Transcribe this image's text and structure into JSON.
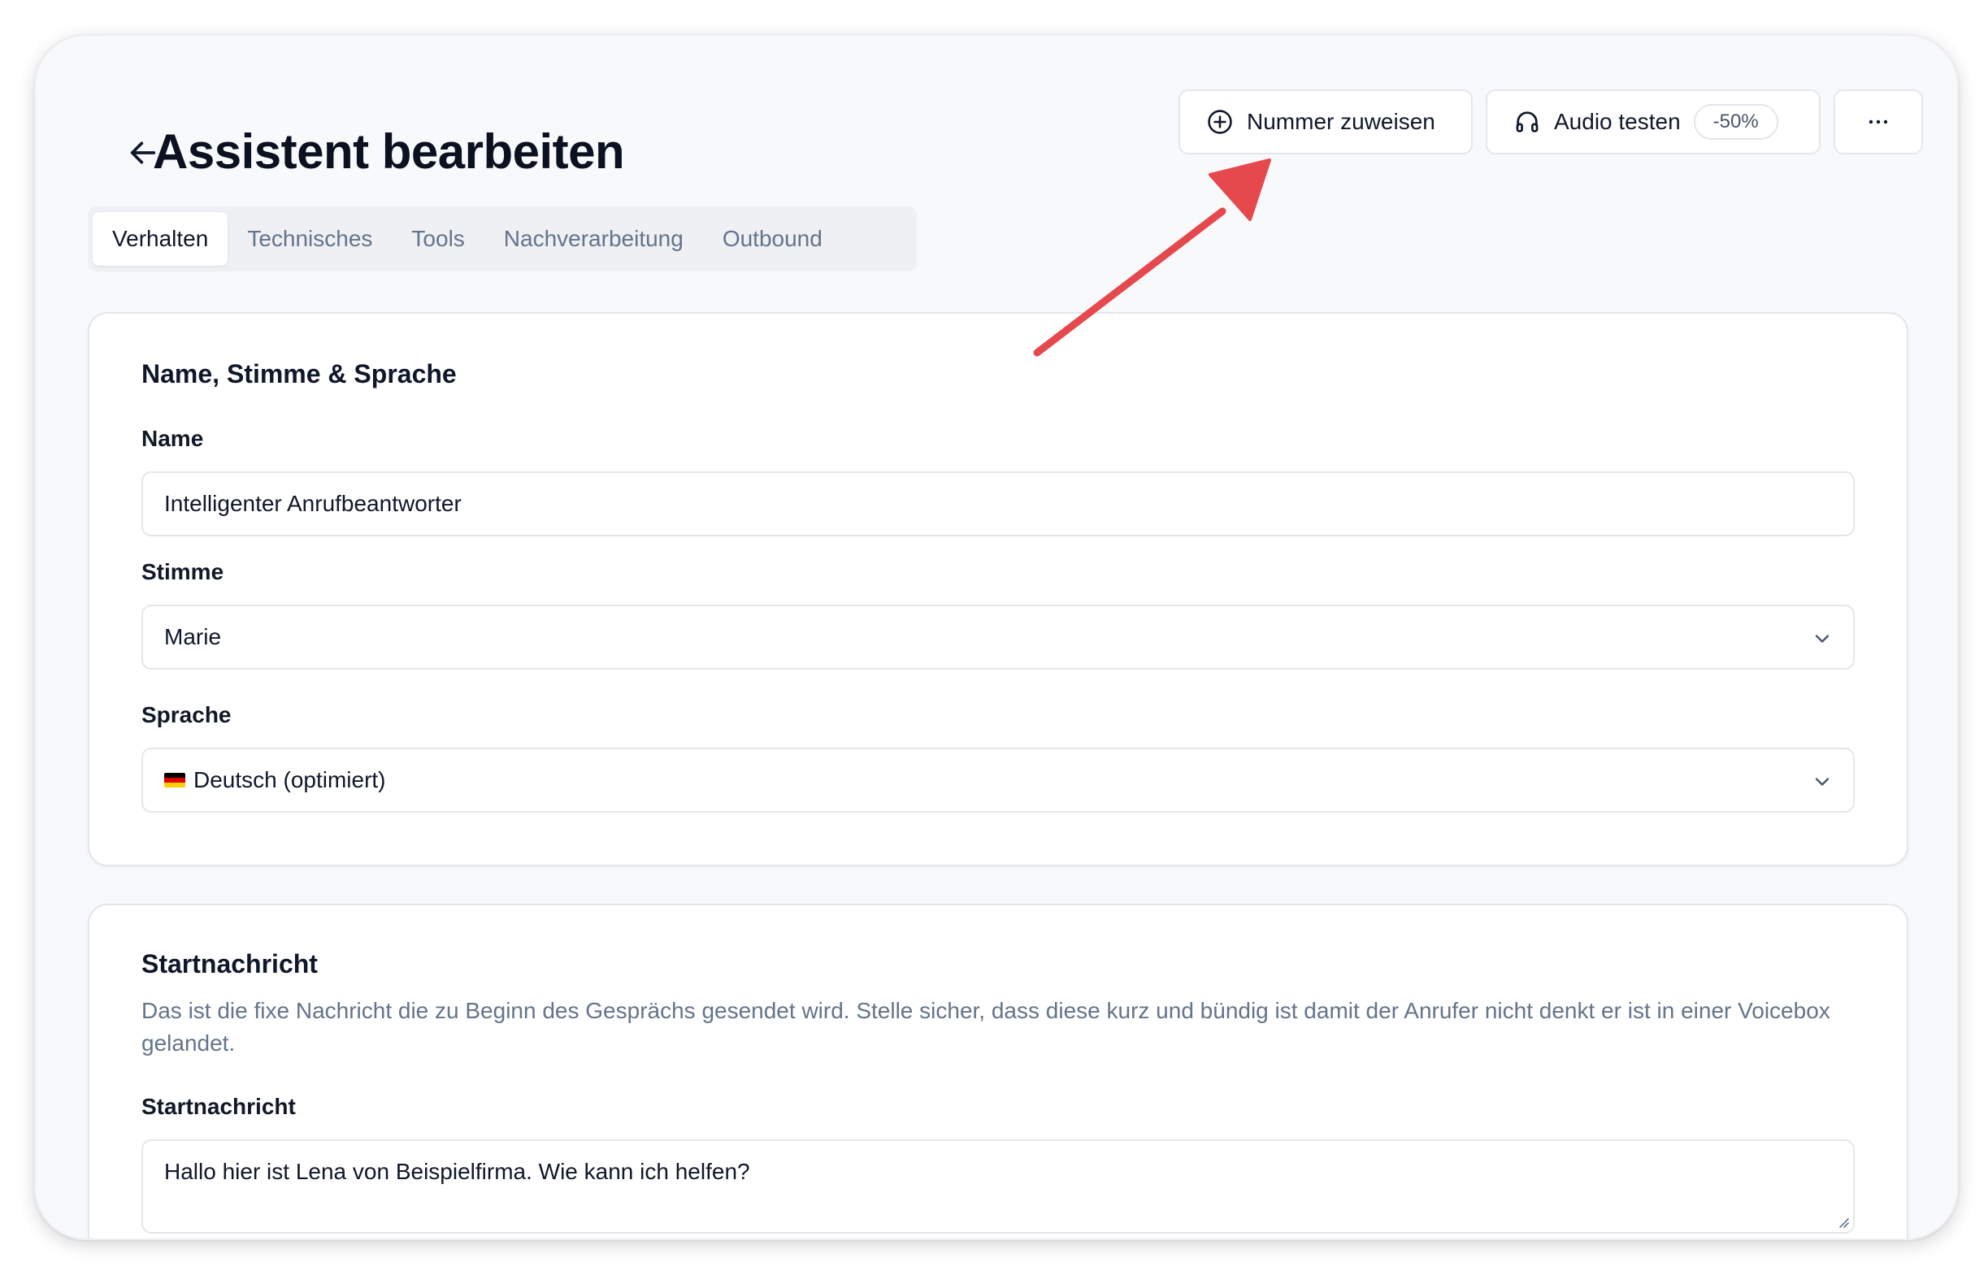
{
  "header": {
    "title": "Assistent bearbeiten",
    "back_icon": "arrow-left-icon",
    "assign_label": "Nummer zuweisen",
    "assign_icon": "plus-circle-icon",
    "audio_label": "Audio testen",
    "audio_icon": "headphones-icon",
    "audio_badge": "-50%",
    "more_icon": "more-horizontal-icon",
    "more_label": "···"
  },
  "tabs": [
    {
      "label": "Verhalten",
      "active": true
    },
    {
      "label": "Technisches",
      "active": false
    },
    {
      "label": "Tools",
      "active": false
    },
    {
      "label": "Nachverarbeitung",
      "active": false
    },
    {
      "label": "Outbound",
      "active": false
    }
  ],
  "section_voice": {
    "title": "Name, Stimme & Sprache",
    "name_label": "Name",
    "name_value": "Intelligenter Anrufbeantworter",
    "voice_label": "Stimme",
    "voice_value": "Marie",
    "language_label": "Sprache",
    "language_value": "Deutsch (optimiert)",
    "language_flag": "german-flag-icon"
  },
  "section_start": {
    "title": "Startnachricht",
    "description": "Das ist die fixe Nachricht die zu Beginn des Gesprächs gesendet wird. Stelle sicher, dass diese kurz und bündig ist damit der Anrufer nicht denkt er ist in einer Voicebox gelandet.",
    "field_label": "Startnachricht",
    "field_value": "Hallo hier ist Lena von Beispielfirma. Wie kann ich helfen?"
  },
  "annotation": {
    "arrow_color": "#e5484d",
    "arrow_icon": "annotation-arrow"
  },
  "colors": {
    "background": "#f8f9fb",
    "muted_text": "#64748b",
    "border": "#e3e6ea"
  }
}
